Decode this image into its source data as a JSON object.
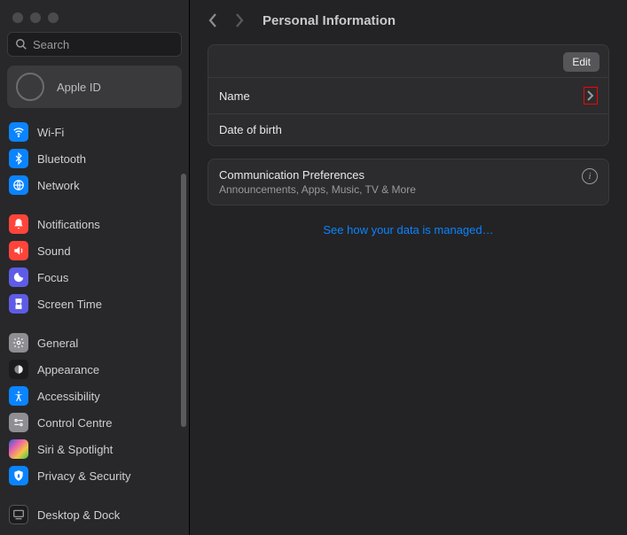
{
  "window": {
    "search_placeholder": "Search",
    "apple_id_label": "Apple ID"
  },
  "sidebar": {
    "groups": [
      {
        "items": [
          {
            "label": "Wi-Fi",
            "icon": "wifi"
          },
          {
            "label": "Bluetooth",
            "icon": "bluetooth"
          },
          {
            "label": "Network",
            "icon": "network"
          }
        ]
      },
      {
        "items": [
          {
            "label": "Notifications",
            "icon": "notifications"
          },
          {
            "label": "Sound",
            "icon": "sound"
          },
          {
            "label": "Focus",
            "icon": "focus"
          },
          {
            "label": "Screen Time",
            "icon": "screentime"
          }
        ]
      },
      {
        "items": [
          {
            "label": "General",
            "icon": "general"
          },
          {
            "label": "Appearance",
            "icon": "appearance"
          },
          {
            "label": "Accessibility",
            "icon": "accessibility"
          },
          {
            "label": "Control Centre",
            "icon": "controlcentre"
          },
          {
            "label": "Siri & Spotlight",
            "icon": "siri"
          },
          {
            "label": "Privacy & Security",
            "icon": "privacy"
          }
        ]
      },
      {
        "items": [
          {
            "label": "Desktop & Dock",
            "icon": "desktop"
          }
        ]
      }
    ]
  },
  "header": {
    "title": "Personal Information"
  },
  "section1": {
    "edit_label": "Edit",
    "rows": [
      {
        "label": "Name"
      },
      {
        "label": "Date of birth"
      }
    ]
  },
  "section2": {
    "title": "Communication Preferences",
    "subtitle": "Announcements, Apps, Music, TV & More"
  },
  "data_link": "See how your data is managed…"
}
